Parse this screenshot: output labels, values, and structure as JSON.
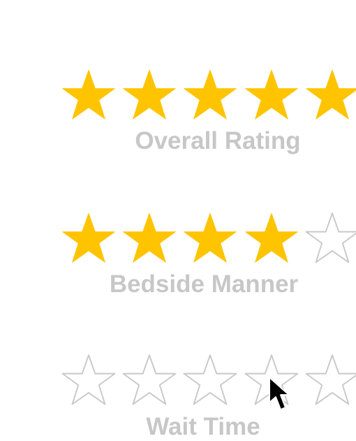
{
  "ratings": [
    {
      "label": "Overall Rating",
      "value": 5,
      "max": 5
    },
    {
      "label": "Bedside Manner",
      "value": 4,
      "max": 5
    },
    {
      "label": "Wait Time",
      "value": 0,
      "max": 5
    }
  ],
  "colors": {
    "filled_star": "#ffc400",
    "empty_star_outline": "#c9c9c9",
    "label_text": "#c7c7c7",
    "background": "#ffffff",
    "cursor": "#000000"
  },
  "icons": {
    "filled": "star-filled-icon",
    "empty": "star-outline-icon",
    "pointer": "mouse-pointer-icon"
  }
}
